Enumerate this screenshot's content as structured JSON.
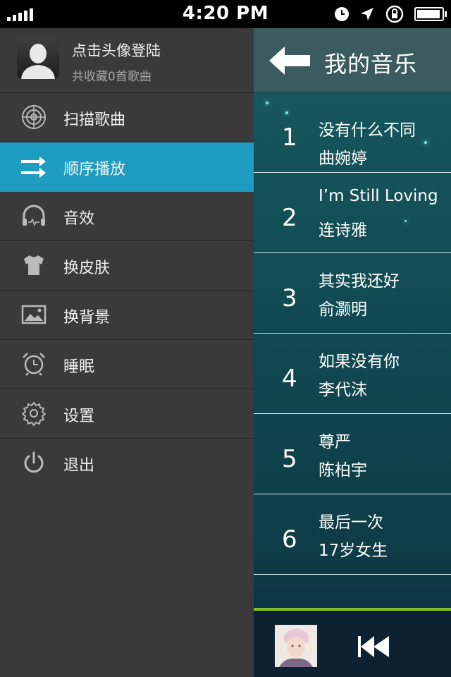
{
  "status_bar": {
    "time": "4:20 PM"
  },
  "user": {
    "login_prompt": "点击头像登陆",
    "collection_count": "共收藏0首歌曲"
  },
  "menu": [
    {
      "label": "扫描歌曲",
      "icon": "radar-icon",
      "active": false
    },
    {
      "label": "顺序播放",
      "icon": "shuffle-arrows-icon",
      "active": true
    },
    {
      "label": "音效",
      "icon": "headphones-icon",
      "active": false
    },
    {
      "label": "换皮肤",
      "icon": "tshirt-icon",
      "active": false
    },
    {
      "label": "换背景",
      "icon": "image-icon",
      "active": false
    },
    {
      "label": "睡眠",
      "icon": "alarm-clock-icon",
      "active": false
    },
    {
      "label": "设置",
      "icon": "gear-icon",
      "active": false
    },
    {
      "label": "退出",
      "icon": "power-icon",
      "active": false
    }
  ],
  "music": {
    "title": "我的音乐",
    "songs": [
      {
        "index": "1",
        "title": "没有什么不同",
        "artist": "曲婉婷"
      },
      {
        "index": "2",
        "title": "I’m Still Loving",
        "artist": "连诗雅"
      },
      {
        "index": "3",
        "title": "其实我还好",
        "artist": "俞灏明"
      },
      {
        "index": "4",
        "title": "如果没有你",
        "artist": "李代沫"
      },
      {
        "index": "5",
        "title": "尊严",
        "artist": "陈柏宇"
      },
      {
        "index": "6",
        "title": "最后一次",
        "artist": "17岁女生"
      }
    ]
  },
  "colors": {
    "accent": "#1f9dc0",
    "progress": "#7fc21e",
    "sidebar_bg": "#3a3a3a",
    "header_bg": "#3b5c5f"
  }
}
